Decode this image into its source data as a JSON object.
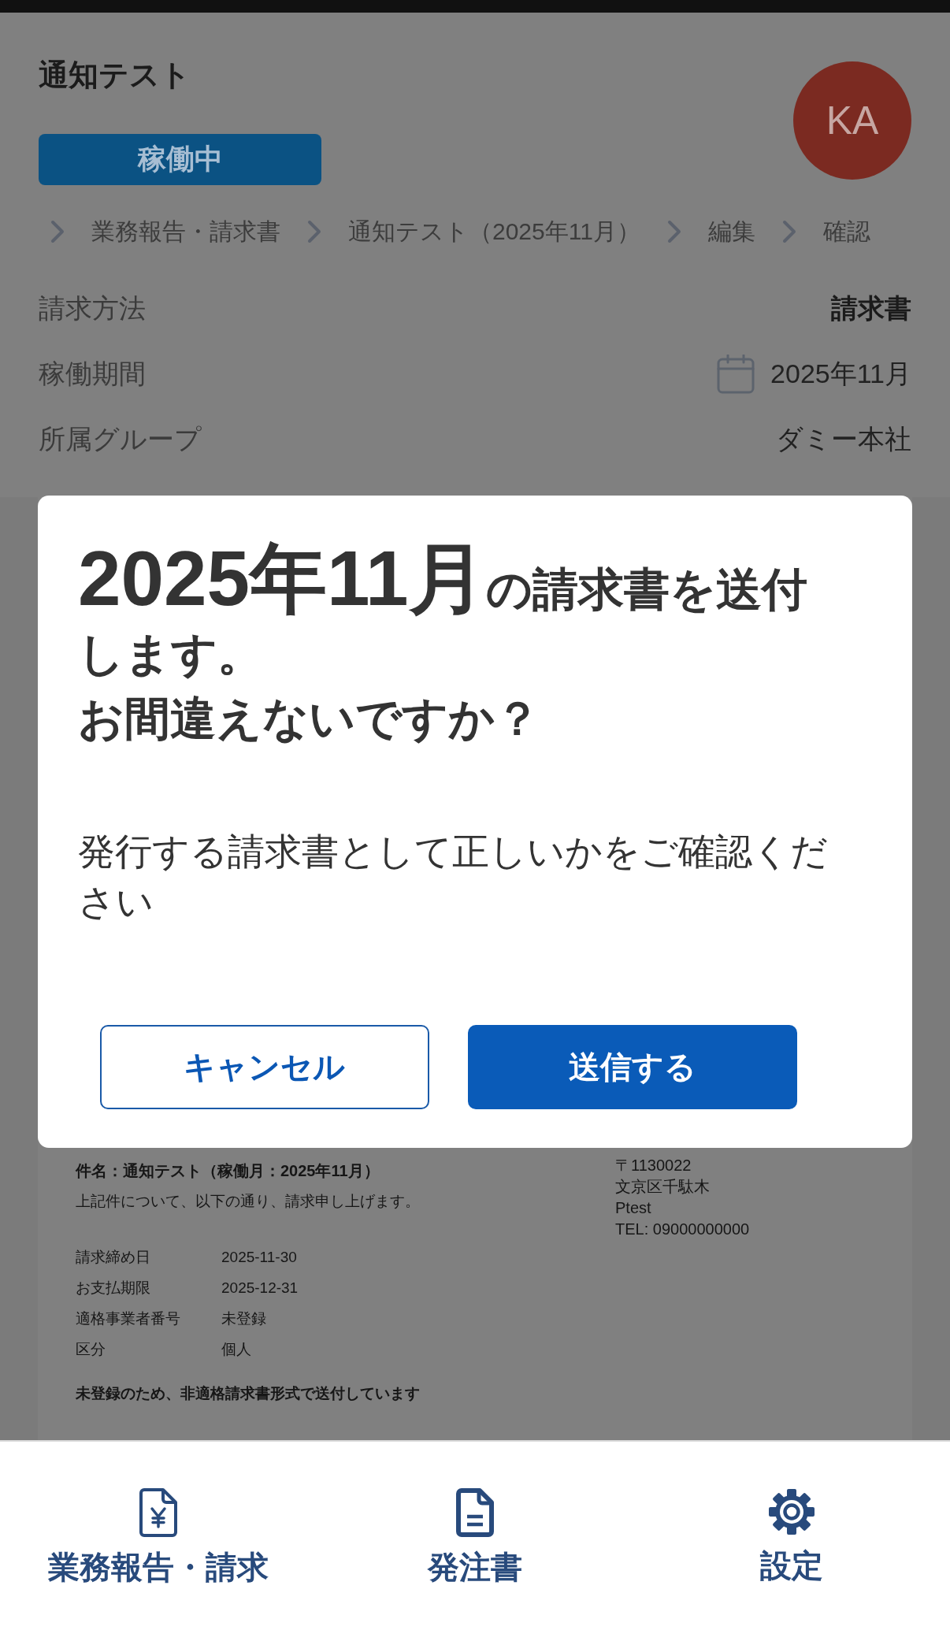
{
  "header": {
    "title": "通知テスト",
    "status": "稼働中",
    "avatar": "KA"
  },
  "breadcrumb": [
    "業務報告・請求書",
    "通知テスト（2025年11月）",
    "編集",
    "確認"
  ],
  "details": [
    {
      "label": "請求方法",
      "value": "請求書",
      "kind": "strong"
    },
    {
      "label": "稼働期間",
      "value": "2025年11月",
      "kind": "period"
    },
    {
      "label": "所属グループ",
      "value": "ダミー本社",
      "kind": "plain"
    }
  ],
  "dialog": {
    "heading": {
      "date": "2025年11月",
      "lines": [
        "の請求書を送付します。",
        "お間違えないですか？"
      ]
    },
    "message": "発行する請求書として正しいかをご確認ください",
    "buttons": [
      {
        "label": "キャンセル",
        "kind": "secondary"
      },
      {
        "label": "送信する",
        "kind": "primary"
      }
    ]
  },
  "document": {
    "subject": "件名：通知テスト（稼働月：2025年11月）",
    "intro": "上記件について、以下の通り、請求申し上げます。",
    "sender": [
      "〒1130022",
      "文京区千駄木",
      "Ptest",
      "TEL: 09000000000"
    ],
    "fields": [
      {
        "label": "請求締め日",
        "value": "2025-11-30"
      },
      {
        "label": "お支払期限",
        "value": "2025-12-31"
      },
      {
        "label": "適格事業者番号",
        "value": "未登録"
      },
      {
        "label": "区分",
        "value": "個人"
      }
    ],
    "notice": "未登録のため、非適格請求書形式で送付しています"
  },
  "bottom_nav": [
    {
      "label": "業務報告・請求"
    },
    {
      "label": "発注書"
    },
    {
      "label": "設定"
    }
  ]
}
